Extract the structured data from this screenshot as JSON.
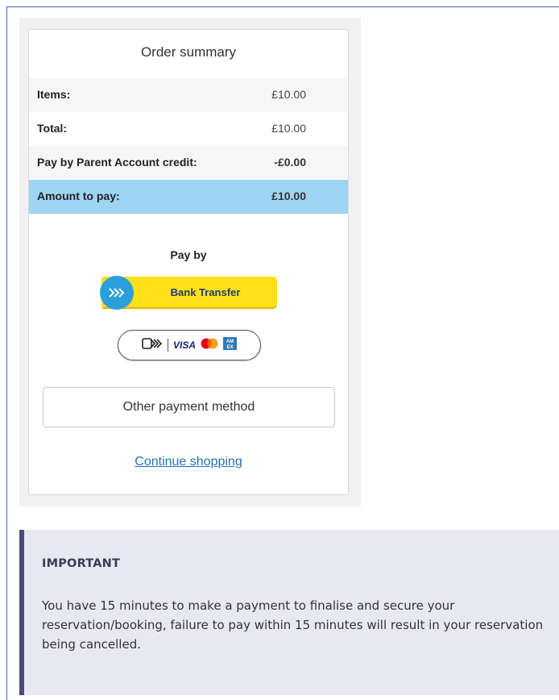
{
  "order_summary": {
    "title": "Order summary",
    "rows": [
      {
        "label": "Items:",
        "value": "£10.00"
      },
      {
        "label": "Total:",
        "value": "£10.00"
      },
      {
        "label": "Pay by Parent Account credit:",
        "value": "-£0.00"
      },
      {
        "label": "Amount to pay:",
        "value": "£10.00"
      }
    ]
  },
  "payment": {
    "pay_by_label": "Pay by",
    "bank_transfer_label": "Bank Transfer",
    "card_brands": [
      "contactless-icon",
      "visa-logo",
      "mastercard-logo",
      "amex-logo"
    ],
    "visa_text": "VISA",
    "amex_text": "AM EX",
    "other_method_label": "Other payment method",
    "continue_label": "Continue shopping"
  },
  "notice": {
    "title": "IMPORTANT",
    "body": "You have 15 minutes to make a payment to finalise and secure your reservation/booking, failure to pay within 15 minutes will result in your reservation being cancelled."
  },
  "colors": {
    "highlight_row": "#9fd5f3",
    "bank_button": "#ffe01b",
    "bank_icon": "#2b9fdc",
    "link": "#2a6fb5",
    "notice_bg": "#e8e8f3",
    "notice_border": "#4a4a7a"
  }
}
